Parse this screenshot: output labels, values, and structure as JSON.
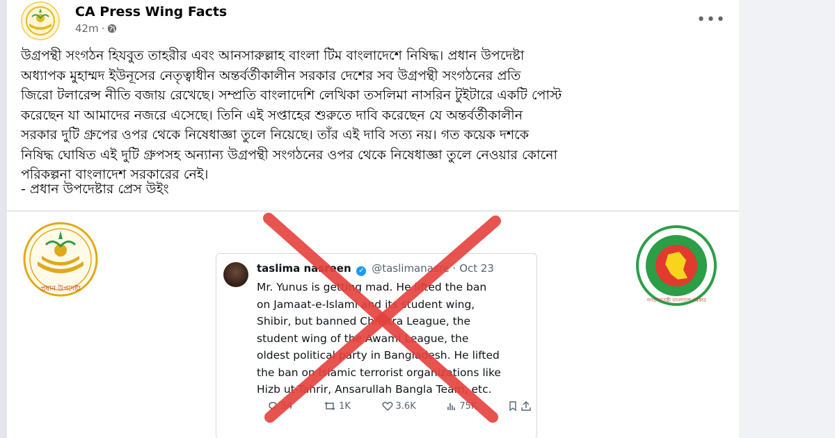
{
  "post": {
    "page_name": "CA Press Wing Facts",
    "time": "42m",
    "separator": "·",
    "menu_icon": "more-horizontal-icon",
    "body": "উগ্রপন্থী সংগঠন হিযবুত তাহরীর এবং আনসারুল্লাহ বাংলা টিম বাংলাদেশে নিষিদ্ধ। প্রধান উপদেষ্টা\nঅধ্যাপক মুহাম্মদ ইউনূসের নেতৃত্বাধীন অন্তর্বর্তীকালীন সরকার দেশের সব উগ্রপন্থী সংগঠনের প্রতি\nজিরো টলারেন্স নীতি বজায় রেখেছে। সম্প্রতি বাংলাদেশি লেখিকা তসলিমা নাসরিন টুইটারে একটি পোস্ট\nকরেছেন যা আমাদের নজরে এসেছে। তিনি এই সপ্তাহের শুরুতে দাবি করেছেন যে অন্তর্বর্তীকালীন\nসরকার দুটি গ্রুপের ওপর থেকে নিষেধাজ্ঞা তুলে নিয়েছে। তাঁর এই দাবি সত্য নয়। গত কয়েক দশকে\nনিষিদ্ধ ঘোষিত এই দুটি গ্রুপসহ অন্যান্য উগ্রপন্থী সংগঠনের ওপর থেকে নিষেধাজ্ঞা তুলে নেওয়ার কোনো\nপরিকল্পনা বাংলাদেশ সরকারের নেই।",
    "signature": "- প্রধান উপদেষ্টার প্রেস উইং"
  },
  "media": {
    "left_logo_caption": "প্রধান উপদেষ্টা",
    "right_logo_caption": "গণপ্রজাতন্ত্রী বাংলাদেশ সরকার",
    "tweet": {
      "name": "taslima n",
      "name_rest": "asreen",
      "handle": "@taslima",
      "handle_rest": "nasre",
      "dot": "·",
      "date": "Oct 23",
      "text": "Mr. Yunus is getting mad. He lifted the ban\non Jamaat-e-Islami and its student wing,\nShibir, but banned Chhatra League, the\nstudent wing of the Awami League, the\noldest political party in Bangladesh. He lifted\nthe ban on Islamic terrorist organizations like\nHizb ut-Tahrir, Ansarullah Bangla Team, etc.",
      "replies": "54",
      "retweets": "1K",
      "likes": "3.6K",
      "views": "75K"
    },
    "cross_color": "#e5413b"
  }
}
